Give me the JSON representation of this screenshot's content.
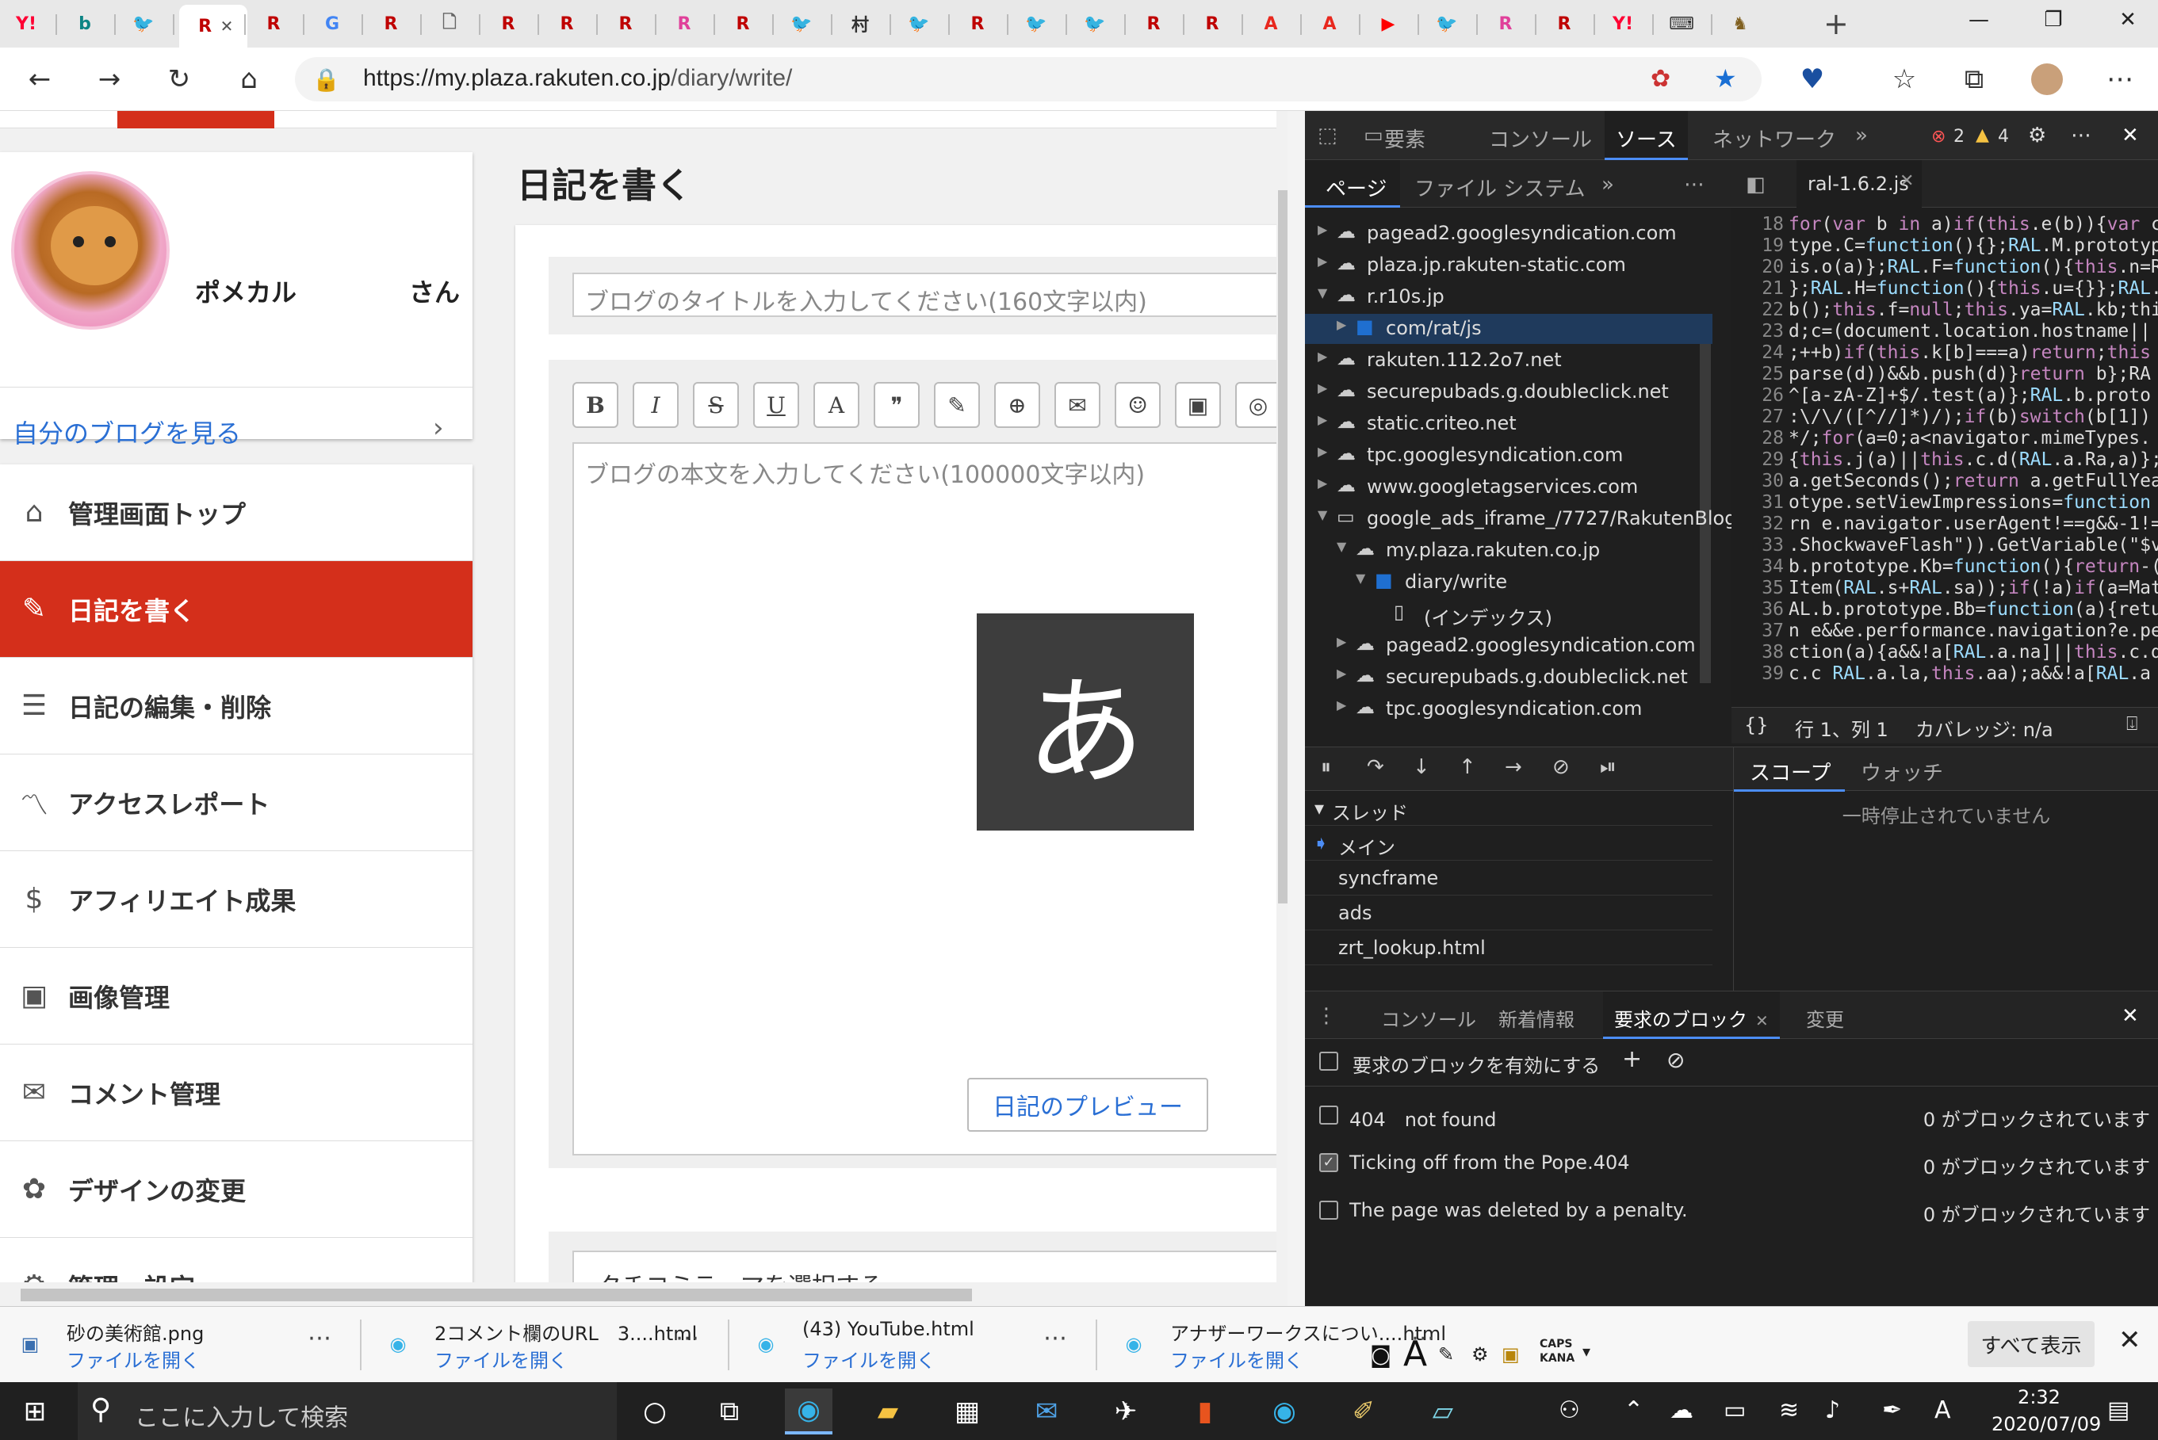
{
  "browser": {
    "url_host": "https://my.plaza.rakuten.co.jp",
    "url_path": "/diary/write/",
    "tabs": [
      {
        "icon": "yahoo-icon",
        "glyph": "Y!",
        "color": "#ff0033"
      },
      {
        "icon": "bing-icon",
        "glyph": "b",
        "color": "#0c8484"
      },
      {
        "icon": "twitter-icon",
        "glyph": "🐦",
        "color": "#1da1f2"
      },
      {
        "icon": "rakuten-icon",
        "glyph": "R",
        "color": "#bf0000",
        "active": true
      },
      {
        "icon": "rakuten-icon",
        "glyph": "R",
        "color": "#bf0000"
      },
      {
        "icon": "google-icon",
        "glyph": "G",
        "color": "#4285f4"
      },
      {
        "icon": "rakuten-icon",
        "glyph": "R",
        "color": "#bf0000"
      },
      {
        "icon": "document-icon",
        "glyph": "🗋",
        "color": "#666666"
      },
      {
        "icon": "rakuten-icon",
        "glyph": "R",
        "color": "#bf0000"
      },
      {
        "icon": "rakuten-icon",
        "glyph": "R",
        "color": "#bf0000"
      },
      {
        "icon": "rakuten-icon",
        "glyph": "R",
        "color": "#bf0000"
      },
      {
        "icon": "rakuten-pink-icon",
        "glyph": "R",
        "color": "#e0409a"
      },
      {
        "icon": "rakuten-icon",
        "glyph": "R",
        "color": "#bf0000"
      },
      {
        "icon": "twitter-icon",
        "glyph": "🐦",
        "color": "#1da1f2"
      },
      {
        "icon": "mura-icon",
        "glyph": "村",
        "color": "#333333"
      },
      {
        "icon": "twitter-icon",
        "glyph": "🐦",
        "color": "#1da1f2"
      },
      {
        "icon": "rakuten-icon",
        "glyph": "R",
        "color": "#bf0000"
      },
      {
        "icon": "twitter-icon",
        "glyph": "🐦",
        "color": "#1da1f2"
      },
      {
        "icon": "twitter-icon",
        "glyph": "🐦",
        "color": "#1da1f2"
      },
      {
        "icon": "rakuten-icon",
        "glyph": "R",
        "color": "#bf0000"
      },
      {
        "icon": "rakuten-round-icon",
        "glyph": "R",
        "color": "#bf0000"
      },
      {
        "icon": "adobe-icon",
        "glyph": "A",
        "color": "#e8281e"
      },
      {
        "icon": "adobe-icon",
        "glyph": "A",
        "color": "#e8281e"
      },
      {
        "icon": "youtube-icon",
        "glyph": "▶",
        "color": "#ff0000"
      },
      {
        "icon": "twitter-icon",
        "glyph": "🐦",
        "color": "#1da1f2"
      },
      {
        "icon": "rakuten-pink-icon",
        "glyph": "R",
        "color": "#e0409a"
      },
      {
        "icon": "rakuten-icon",
        "glyph": "R",
        "color": "#bf0000"
      },
      {
        "icon": "yahoo-icon",
        "glyph": "Y!",
        "color": "#ff0033"
      },
      {
        "icon": "keyboard-icon",
        "glyph": "⌨",
        "color": "#333333"
      },
      {
        "icon": "game-icon",
        "glyph": "♞",
        "color": "#806020"
      }
    ]
  },
  "page": {
    "heading": "日記を書く",
    "username": "ポメカル",
    "user_suffix": "さん",
    "my_blog_link": "自分のブログを見る",
    "menu": [
      {
        "icon": "home-icon",
        "glyph": "⌂",
        "label": "管理画面トップ"
      },
      {
        "icon": "pencil-icon",
        "glyph": "✎",
        "label": "日記を書く",
        "active": true
      },
      {
        "icon": "list-icon",
        "glyph": "☰",
        "label": "日記の編集・削除"
      },
      {
        "icon": "trend-icon",
        "glyph": "〽",
        "label": "アクセスレポート"
      },
      {
        "icon": "moneybag-icon",
        "glyph": "$",
        "label": "アフィリエイト成果"
      },
      {
        "icon": "image-icon",
        "glyph": "▣",
        "label": "画像管理"
      },
      {
        "icon": "comment-icon",
        "glyph": "✉",
        "label": "コメント管理"
      },
      {
        "icon": "palette-icon",
        "glyph": "✿",
        "label": "デザインの変更"
      },
      {
        "icon": "settings-icon",
        "glyph": "⚙",
        "label": "管理・設定"
      }
    ],
    "title_placeholder": "ブログのタイトルを入力してください(160文字以内)",
    "body_placeholder": "ブログの本文を入力してください(100000文字以内)",
    "toolbar": [
      {
        "icon": "bold-icon",
        "glyph": "B"
      },
      {
        "icon": "italic-icon",
        "glyph": "I"
      },
      {
        "icon": "strikethrough-icon",
        "glyph": "S"
      },
      {
        "icon": "underline-icon",
        "glyph": "U"
      },
      {
        "icon": "font-size-icon",
        "glyph": "A"
      },
      {
        "icon": "quote-icon",
        "glyph": "❞"
      },
      {
        "icon": "edit-box-icon",
        "glyph": "✎"
      },
      {
        "icon": "globe-icon",
        "glyph": "⊕"
      },
      {
        "icon": "mail-icon",
        "glyph": "✉"
      },
      {
        "icon": "emoji-icon",
        "glyph": "☺"
      },
      {
        "icon": "image-icon",
        "glyph": "▣"
      },
      {
        "icon": "camera-icon",
        "glyph": "◎"
      }
    ],
    "ime_char": "あ",
    "preview_button": "日記のプレビュー",
    "kuchikomi": "クチコミテーマを選択する"
  },
  "devtools": {
    "main_tabs": [
      "要素",
      "コンソール",
      "ソース",
      "ネットワーク"
    ],
    "selected_main_tab": "ソース",
    "error_count": "2",
    "warning_count": "4",
    "sub_tabs": [
      "ページ",
      "ファイル システム"
    ],
    "open_file": "ral-1.6.2.js",
    "tree": [
      {
        "label": "pagead2.googlesyndication.com",
        "kind": "cloud",
        "depth": 1,
        "arrow": "▶"
      },
      {
        "label": "plaza.jp.rakuten-static.com",
        "kind": "cloud",
        "depth": 1,
        "arrow": "▶"
      },
      {
        "label": "r.r10s.jp",
        "kind": "cloud",
        "depth": 1,
        "arrow": "▼"
      },
      {
        "label": "com/rat/js",
        "kind": "folder",
        "depth": 2,
        "arrow": "▶",
        "selected": true
      },
      {
        "label": "rakuten.112.2o7.net",
        "kind": "cloud",
        "depth": 1,
        "arrow": "▶"
      },
      {
        "label": "securepubads.g.doubleclick.net",
        "kind": "cloud",
        "depth": 1,
        "arrow": "▶"
      },
      {
        "label": "static.criteo.net",
        "kind": "cloud",
        "depth": 1,
        "arrow": "▶"
      },
      {
        "label": "tpc.googlesyndication.com",
        "kind": "cloud",
        "depth": 1,
        "arrow": "▶"
      },
      {
        "label": "www.googletagservices.com",
        "kind": "cloud",
        "depth": 1,
        "arrow": "▶"
      },
      {
        "label": "google_ads_iframe_/7727/RakutenBlog",
        "kind": "frame",
        "depth": 1,
        "arrow": "▼"
      },
      {
        "label": "my.plaza.rakuten.co.jp",
        "kind": "cloud",
        "depth": 2,
        "arrow": "▼"
      },
      {
        "label": "diary/write",
        "kind": "folder",
        "depth": 3,
        "arrow": "▼"
      },
      {
        "label": "(インデックス)",
        "kind": "file",
        "depth": 4,
        "arrow": ""
      },
      {
        "label": "pagead2.googlesyndication.com",
        "kind": "cloud",
        "depth": 2,
        "arrow": "▶"
      },
      {
        "label": "securepubads.g.doubleclick.net",
        "kind": "cloud",
        "depth": 2,
        "arrow": "▶"
      },
      {
        "label": "tpc.googlesyndication.com",
        "kind": "cloud",
        "depth": 2,
        "arrow": "▶"
      }
    ],
    "code_lines": [
      {
        "n": "18",
        "t": "for(var b in a)if(this.e(b)){var c"
      },
      {
        "n": "19",
        "t": "type.C=function(){};RAL.M.prototype"
      },
      {
        "n": "20",
        "t": "is.o(a)};RAL.F=function(){this.n=RA"
      },
      {
        "n": "21",
        "t": "};RAL.H=function(){this.u={}};RAL.H"
      },
      {
        "n": "22",
        "t": "b();this.f=null;this.ya=RAL.kb;thi"
      },
      {
        "n": "23",
        "t": "d;c=(document.location.hostname||"
      },
      {
        "n": "24",
        "t": ";++b)if(this.k[b]===a)return;this"
      },
      {
        "n": "25",
        "t": "parse(d))&&b.push(d)}return b};RA"
      },
      {
        "n": "26",
        "t": "^[a-zA-Z]+$/.test(a)};RAL.b.proto"
      },
      {
        "n": "27",
        "t": ":\\/\\/([^//]*)/);if(b)switch(b[1])"
      },
      {
        "n": "28",
        "t": "*/;for(a=0;a<navigator.mimeTypes."
      },
      {
        "n": "29",
        "t": "{this.j(a)||this.c.d(RAL.a.Ra,a)};"
      },
      {
        "n": "30",
        "t": "a.getSeconds();return a.getFullYear"
      },
      {
        "n": "31",
        "t": "otype.setViewImpressions=function"
      },
      {
        "n": "32",
        "t": "rn e.navigator.userAgent!==g&&-1!="
      },
      {
        "n": "33",
        "t": ".ShockwaveFlash\")).GetVariable(\"$ve"
      },
      {
        "n": "34",
        "t": "b.prototype.Kb=function(){return-("
      },
      {
        "n": "35",
        "t": "Item(RAL.s+RAL.sa));if(!a)if(a=Math"
      },
      {
        "n": "36",
        "t": "AL.b.prototype.Bb=function(a){retur"
      },
      {
        "n": "37",
        "t": "n e&&e.performance.navigation?e.per"
      },
      {
        "n": "38",
        "t": "ction(a){a&&!a[RAL.a.na]||this.c.d"
      },
      {
        "n": "39",
        "t": "c.c RAL.a.la,this.aa);a&&!a[RAL.a"
      }
    ],
    "status_line": "行 1、列 1",
    "coverage": "カバレッジ: n/a",
    "threads_header": "スレッド",
    "threads": [
      "メイン",
      "syncframe",
      "ads",
      "zrt_lookup.html"
    ],
    "scope_tabs": [
      "スコープ",
      "ウォッチ"
    ],
    "scope_msg": "一時停止されていません",
    "drawer_tabs": [
      "コンソール",
      "新着情報",
      "要求のブロック",
      "変更"
    ],
    "drawer_selected": "要求のブロック",
    "enable_blocking": "要求のブロックを有効にする",
    "patterns": [
      {
        "text": "404　not found",
        "checked": false,
        "count": "0 がブロックされています"
      },
      {
        "text": "Ticking off from the Pope.404",
        "checked": true,
        "count": "0 がブロックされています"
      },
      {
        "text": "The page was deleted by a penalty.",
        "checked": false,
        "count": "0 がブロックされています"
      }
    ]
  },
  "downloads": {
    "items": [
      {
        "name": "砂の美術館.png",
        "action": "ファイルを開く",
        "icon": "png-file-icon"
      },
      {
        "name": "2コメント欄のURL　3....html",
        "action": "ファイルを開く",
        "icon": "edge-beta-icon"
      },
      {
        "name": "(43) YouTube.html",
        "action": "ファイルを開く",
        "icon": "edge-beta-icon"
      },
      {
        "name": "アナザーワークスについ....html",
        "action": "ファイルを開く",
        "icon": "edge-beta-icon"
      }
    ],
    "show_all": "すべて表示"
  },
  "taskbar": {
    "search_placeholder": "ここに入力して検索",
    "time": "2:32",
    "date": "2020/07/09",
    "ime_indicator": "A",
    "caps": "CAPS",
    "kana": "KANA"
  }
}
